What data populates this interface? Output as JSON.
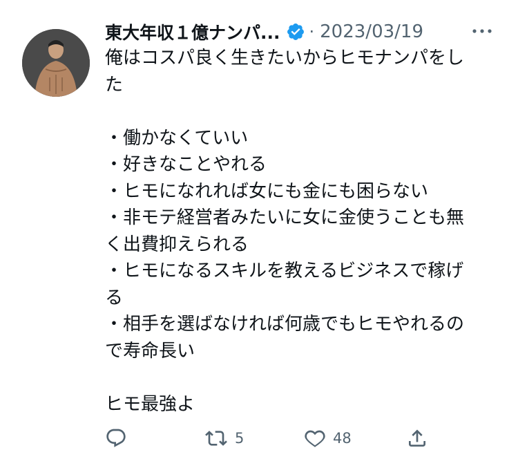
{
  "tweet": {
    "author_name": "東大年収１億ナンパ...",
    "separator": "·",
    "date": "2023/03/19",
    "lines": [
      "俺はコスパ良く生きたいからヒモナンパをし",
      "た",
      "",
      "・働かなくていい",
      "・好きなことやれる",
      "・ヒモになれれば女にも金にも困らない",
      "・非モテ経営者みたいに女に金使うことも無",
      "く出費抑えられる",
      "・ヒモになるスキルを教えるビジネスで稼げ",
      "る",
      "・相手を選ばなければ何歳でもヒモやれるの",
      "で寿命長い",
      "",
      "ヒモ最強よ"
    ]
  },
  "actions": {
    "reply_icon": "reply-icon",
    "retweet_icon": "retweet-icon",
    "retweet_count": "5",
    "like_icon": "heart-icon",
    "like_count": "48",
    "share_icon": "share-icon"
  },
  "colors": {
    "text": "#0f1419",
    "secondary": "#536471",
    "verified": "#1d9bf0"
  }
}
